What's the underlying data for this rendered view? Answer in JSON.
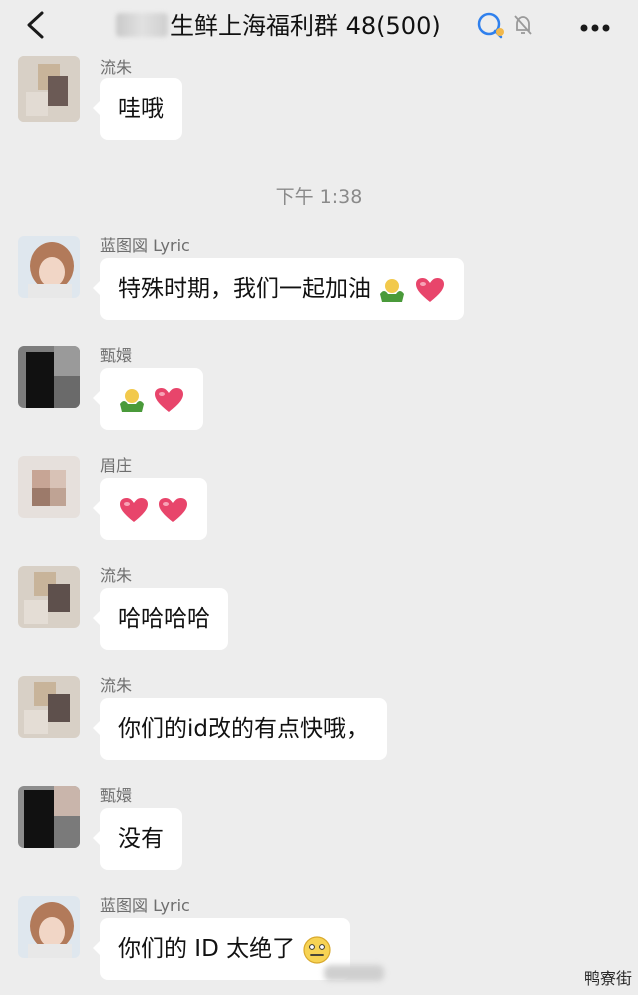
{
  "header": {
    "title": "生鲜上海福利群 48(500)",
    "back_icon": "chevron-left-icon",
    "chat_icon": "chat-bubble-icon",
    "mute_icon": "bell-muted-icon",
    "more_icon": "more-dots-icon"
  },
  "timestamp": "下午 1:38",
  "messages": [
    {
      "sender": "流朱",
      "text": "哇哦",
      "emoji": []
    },
    {
      "sender": "蓝图図 Lyric",
      "text": "特殊时期，我们一起加油",
      "emoji": [
        "muscle-emoji",
        "heart-emoji"
      ]
    },
    {
      "sender": "甄嬛",
      "text": "",
      "emoji": [
        "muscle-emoji",
        "heart-emoji"
      ]
    },
    {
      "sender": "眉庄",
      "text": "",
      "emoji": [
        "heart-emoji",
        "heart-emoji"
      ]
    },
    {
      "sender": "流朱",
      "text": "哈哈哈哈",
      "emoji": []
    },
    {
      "sender": "流朱",
      "text": "你们的id改的有点快哦，",
      "emoji": []
    },
    {
      "sender": "甄嬛",
      "text": "没有",
      "emoji": []
    },
    {
      "sender": "蓝图図 Lyric",
      "text": "你们的 ID 太绝了",
      "emoji": [
        "awkward-smile-emoji"
      ]
    }
  ],
  "watermark": "鸭寮街",
  "colors": {
    "background": "#ededed",
    "bubble": "#ffffff",
    "heart": "#e8456b",
    "muscle_body": "#4a9a3a",
    "muscle_face": "#f2c94c"
  }
}
